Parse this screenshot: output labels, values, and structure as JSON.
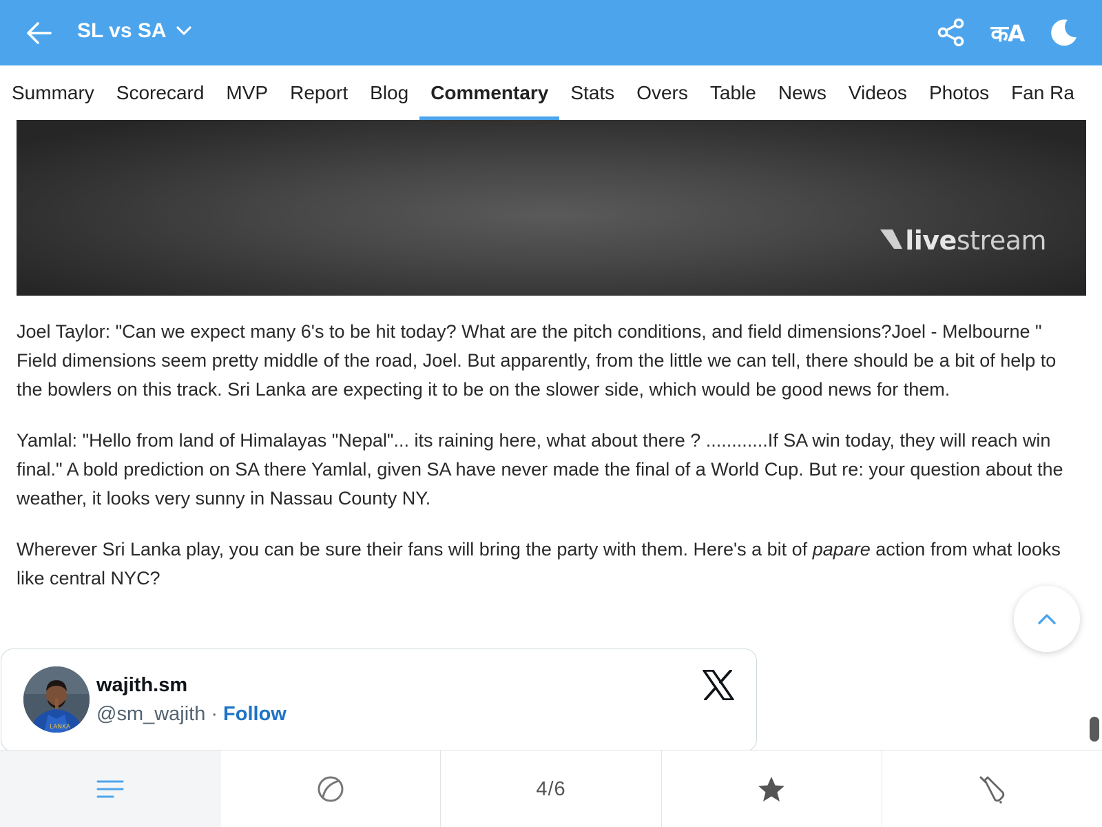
{
  "header": {
    "title": "SL vs SA",
    "back_icon": "arrow-left-icon",
    "actions": [
      "share-icon",
      "language-icon",
      "dark-mode-icon"
    ],
    "language_label": "कA",
    "background_color": "#4ca5ec"
  },
  "tabs": [
    {
      "label": "Summary",
      "active": false
    },
    {
      "label": "Scorecard",
      "active": false
    },
    {
      "label": "MVP",
      "active": false
    },
    {
      "label": "Report",
      "active": false
    },
    {
      "label": "Blog",
      "active": false
    },
    {
      "label": "Commentary",
      "active": true
    },
    {
      "label": "Stats",
      "active": false
    },
    {
      "label": "Overs",
      "active": false
    },
    {
      "label": "Table",
      "active": false
    },
    {
      "label": "News",
      "active": false
    },
    {
      "label": "Videos",
      "active": false
    },
    {
      "label": "Photos",
      "active": false
    },
    {
      "label": "Fan Ra",
      "active": false
    }
  ],
  "video": {
    "brand_part1": "live",
    "brand_part2": "stream"
  },
  "commentary": {
    "para1": "Joel Taylor: \"Can we expect many 6's to be hit today? What are the pitch conditions, and field dimensions?Joel - Melbourne \" Field dimensions seem pretty middle of the road, Joel. But apparently, from the little we can tell, there should be a bit of help to the bowlers on this track. Sri Lanka are expecting it to be on the slower side, which would be good news for them.",
    "para2": "Yamlal: \"Hello from land of Himalayas \"Nepal\"... its raining here, what about there ? ............If SA win today, they will reach win final.\" A bold prediction on SA there Yamlal, given SA have never made the final of a World Cup. But re: your question about the weather, it looks very sunny in Nassau County NY.",
    "para3_before": "Wherever Sri Lanka play, you can be sure their fans will bring the party with them. Here's a bit of ",
    "para3_italic": "papare",
    "para3_after": " action from what looks like central NYC?"
  },
  "tweet": {
    "name": "wajith.sm",
    "handle": "@sm_wajith",
    "separator": "·",
    "follow_label": "Follow",
    "avatar_shirt_text": "LANKA",
    "platform_icon": "x-logo-icon"
  },
  "bottom_nav": {
    "items": [
      "menu-icon",
      "ball-icon",
      "page-indicator",
      "star-icon",
      "bat-icon"
    ],
    "page_indicator": "4/6",
    "accent_color": "#4ca5ec"
  }
}
